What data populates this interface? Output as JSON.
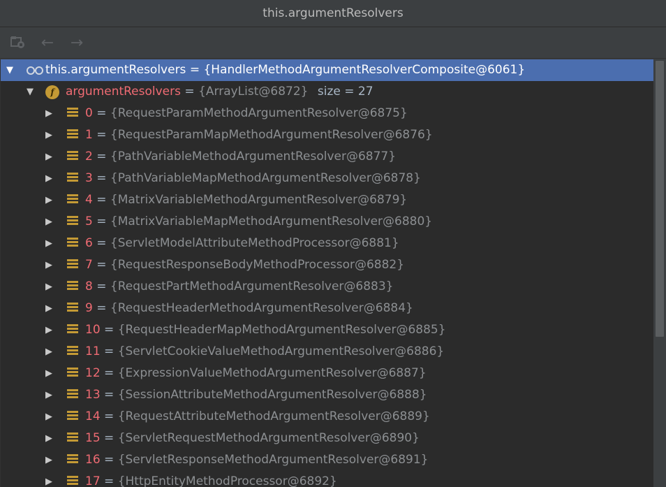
{
  "window": {
    "title": "this.argumentResolvers"
  },
  "toolbar": {
    "buttons": [
      {
        "name": "frames-icon"
      },
      {
        "name": "back-arrow-icon",
        "glyph": "←"
      },
      {
        "name": "forward-arrow-icon",
        "glyph": "→"
      }
    ]
  },
  "tree": {
    "root": {
      "name": "this.argumentResolvers",
      "value": "{HandlerMethodArgumentResolverComposite@6061}"
    },
    "field": {
      "name": "argumentResolvers",
      "value": "{ArrayList@6872}",
      "size_label": "size = 27"
    },
    "items": [
      {
        "index": "0",
        "value": "{RequestParamMethodArgumentResolver@6875}"
      },
      {
        "index": "1",
        "value": "{RequestParamMapMethodArgumentResolver@6876}"
      },
      {
        "index": "2",
        "value": "{PathVariableMethodArgumentResolver@6877}"
      },
      {
        "index": "3",
        "value": "{PathVariableMapMethodArgumentResolver@6878}"
      },
      {
        "index": "4",
        "value": "{MatrixVariableMethodArgumentResolver@6879}"
      },
      {
        "index": "5",
        "value": "{MatrixVariableMapMethodArgumentResolver@6880}"
      },
      {
        "index": "6",
        "value": "{ServletModelAttributeMethodProcessor@6881}"
      },
      {
        "index": "7",
        "value": "{RequestResponseBodyMethodProcessor@6882}"
      },
      {
        "index": "8",
        "value": "{RequestPartMethodArgumentResolver@6883}"
      },
      {
        "index": "9",
        "value": "{RequestHeaderMethodArgumentResolver@6884}"
      },
      {
        "index": "10",
        "value": "{RequestHeaderMapMethodArgumentResolver@6885}"
      },
      {
        "index": "11",
        "value": "{ServletCookieValueMethodArgumentResolver@6886}"
      },
      {
        "index": "12",
        "value": "{ExpressionValueMethodArgumentResolver@6887}"
      },
      {
        "index": "13",
        "value": "{SessionAttributeMethodArgumentResolver@6888}"
      },
      {
        "index": "14",
        "value": "{RequestAttributeMethodArgumentResolver@6889}"
      },
      {
        "index": "15",
        "value": "{ServletRequestMethodArgumentResolver@6890}"
      },
      {
        "index": "16",
        "value": "{ServletResponseMethodArgumentResolver@6891}"
      },
      {
        "index": "17",
        "value": "{HttpEntityMethodProcessor@6892}"
      }
    ]
  },
  "colors": {
    "selection": "#4b6eaf",
    "field_name": "#ef6b73",
    "value_text": "#8c8f92",
    "icon_gold": "#c49a35"
  }
}
